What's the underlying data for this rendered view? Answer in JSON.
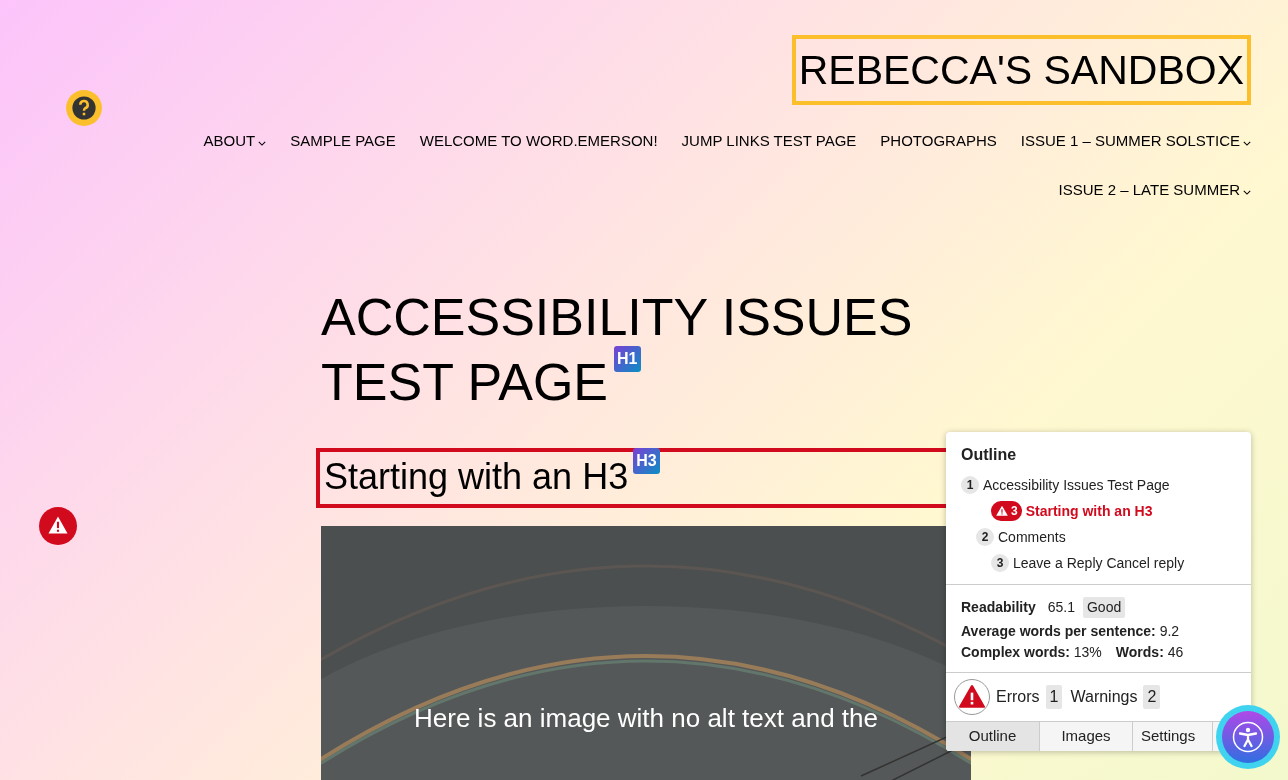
{
  "site_title": "REBECCA'S SANDBOX",
  "nav": [
    {
      "label": "ABOUT",
      "has_submenu": true
    },
    {
      "label": "SAMPLE PAGE",
      "has_submenu": false
    },
    {
      "label": "WELCOME TO WORD.EMERSON!",
      "has_submenu": false
    },
    {
      "label": "JUMP LINKS TEST PAGE",
      "has_submenu": false
    },
    {
      "label": "PHOTOGRAPHS",
      "has_submenu": false
    },
    {
      "label": "ISSUE 1 – SUMMER SOLSTICE",
      "has_submenu": true
    },
    {
      "label": "ISSUE 2 – LATE SUMMER",
      "has_submenu": true
    }
  ],
  "page_title": {
    "lines": [
      "ACCESSIBILITY ISSUES",
      "TEST PAGE"
    ],
    "badge": "H1"
  },
  "heading": {
    "text": "Starting with an H3",
    "badge": "H3",
    "error": true
  },
  "image": {
    "kind": "picture",
    "caption": "Here is an image with no alt text and the"
  },
  "panel": {
    "title": "Outline",
    "outline": [
      {
        "level": "1",
        "text": "Accessibility Issues Test Page",
        "error": false,
        "children": [
          {
            "level": "3",
            "text": "Starting with an H3",
            "error": true
          },
          {
            "level": "2",
            "text": "Comments",
            "error": false,
            "children": [
              {
                "level": "3",
                "text": "Leave a Reply Cancel reply",
                "error": false
              }
            ]
          }
        ]
      }
    ],
    "readability": {
      "label": "Readability",
      "score": "65.1",
      "rating": "Good"
    },
    "stats": [
      {
        "label": "Average words per sentence:",
        "value": "9.2"
      },
      {
        "label": "Complex words:",
        "value": "13%"
      },
      {
        "label": "Words:",
        "value": "46"
      }
    ],
    "counts": [
      {
        "label": "Errors",
        "value": "1"
      },
      {
        "label": "Warnings",
        "value": "2"
      }
    ],
    "tabs": [
      {
        "label": "Outline",
        "selected": true
      },
      {
        "label": "Images",
        "selected": false
      },
      {
        "label": "Settings",
        "selected": false
      }
    ]
  }
}
